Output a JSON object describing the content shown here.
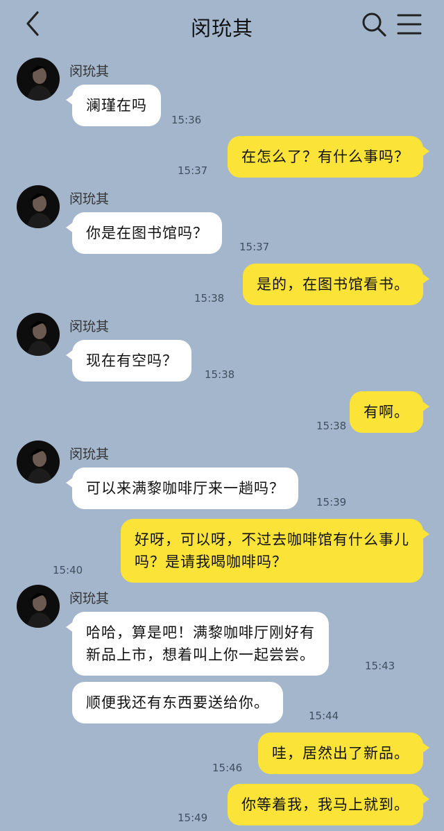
{
  "header": {
    "title": "闵玧其",
    "back_icon": "chevron-left-icon",
    "search_icon": "search-icon",
    "menu_icon": "menu-icon"
  },
  "contact_name": "闵玧其",
  "colors": {
    "background": "#a3b6cb",
    "incoming_bubble": "#ffffff",
    "outgoing_bubble": "#fbe337"
  },
  "messages": [
    {
      "from": "闵玧其",
      "text": "澜瑾在吗",
      "time": "15:36"
    },
    {
      "from": "me",
      "text": "在怎么了？有什么事吗？",
      "time": "15:37"
    },
    {
      "from": "闵玧其",
      "text": "你是在图书馆吗？",
      "time": "15:37"
    },
    {
      "from": "me",
      "text": "是的，在图书馆看书。",
      "time": "15:38"
    },
    {
      "from": "闵玧其",
      "text": "现在有空吗？",
      "time": "15:38"
    },
    {
      "from": "me",
      "text": "有啊。",
      "time": "15:38"
    },
    {
      "from": "闵玧其",
      "text": "可以来满黎咖啡厅来一趟吗？",
      "time": "15:39"
    },
    {
      "from": "me",
      "lines": [
        "好呀，可以呀，不过去咖啡馆有什么事儿",
        "吗？是请我喝咖啡吗？"
      ],
      "time": "15:40"
    },
    {
      "from": "闵玧其",
      "lines": [
        "哈哈，算是吧！满黎咖啡厅刚好有",
        "新品上市，想着叫上你一起尝尝。"
      ],
      "time": "15:43"
    },
    {
      "from": "闵玧其",
      "text": "顺便我还有东西要送给你。",
      "time": "15:44"
    },
    {
      "from": "me",
      "text": "哇，居然出了新品。",
      "time": "15:46"
    },
    {
      "from": "me",
      "text": "你等着我，我马上就到。",
      "time": "15:49"
    }
  ]
}
